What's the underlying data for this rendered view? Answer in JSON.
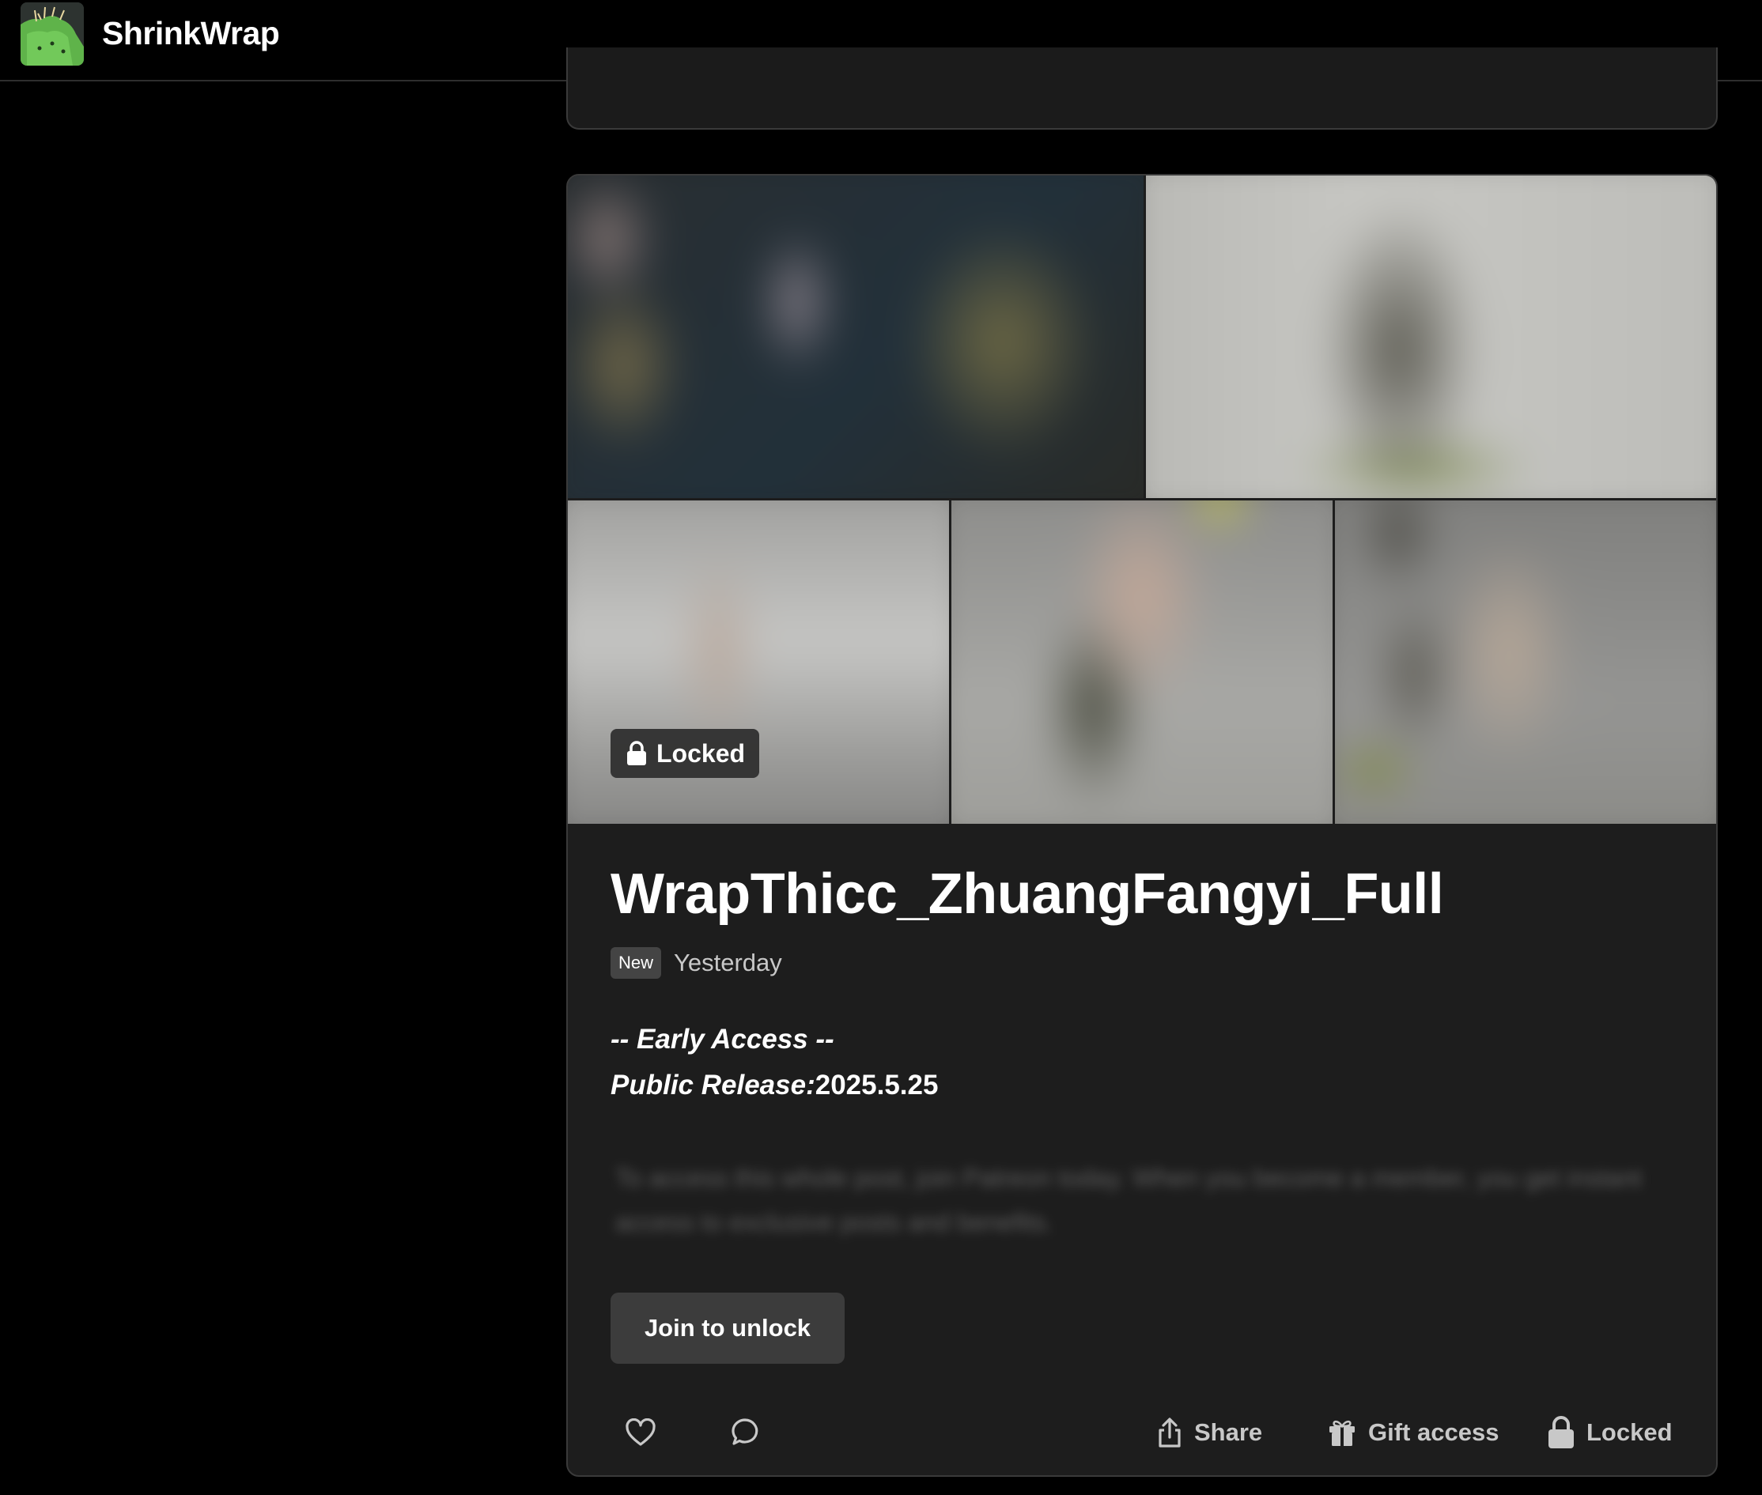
{
  "header": {
    "brand": "ShrinkWrap"
  },
  "post": {
    "locked_badge": "Locked",
    "title": "WrapThicc_ZhuangFangyi_Full",
    "new_badge": "New",
    "date": "Yesterday",
    "early_access": "-- Early Access --",
    "public_release_label": "Public Release:",
    "public_release_value": "2025.5.25",
    "teaser": "To access this whole post, join Patreon today. When you become a member, you get instant access to exclusive posts and benefits.",
    "join_button": "Join to unlock",
    "actions": {
      "share": "Share",
      "gift": "Gift access",
      "locked": "Locked"
    }
  },
  "icons": {
    "logo": "cactus-logo",
    "badge_lock": "lock-icon",
    "like": "heart-icon",
    "comment": "comment-icon",
    "share": "share-icon",
    "gift": "gift-icon",
    "locked": "lock-icon"
  }
}
